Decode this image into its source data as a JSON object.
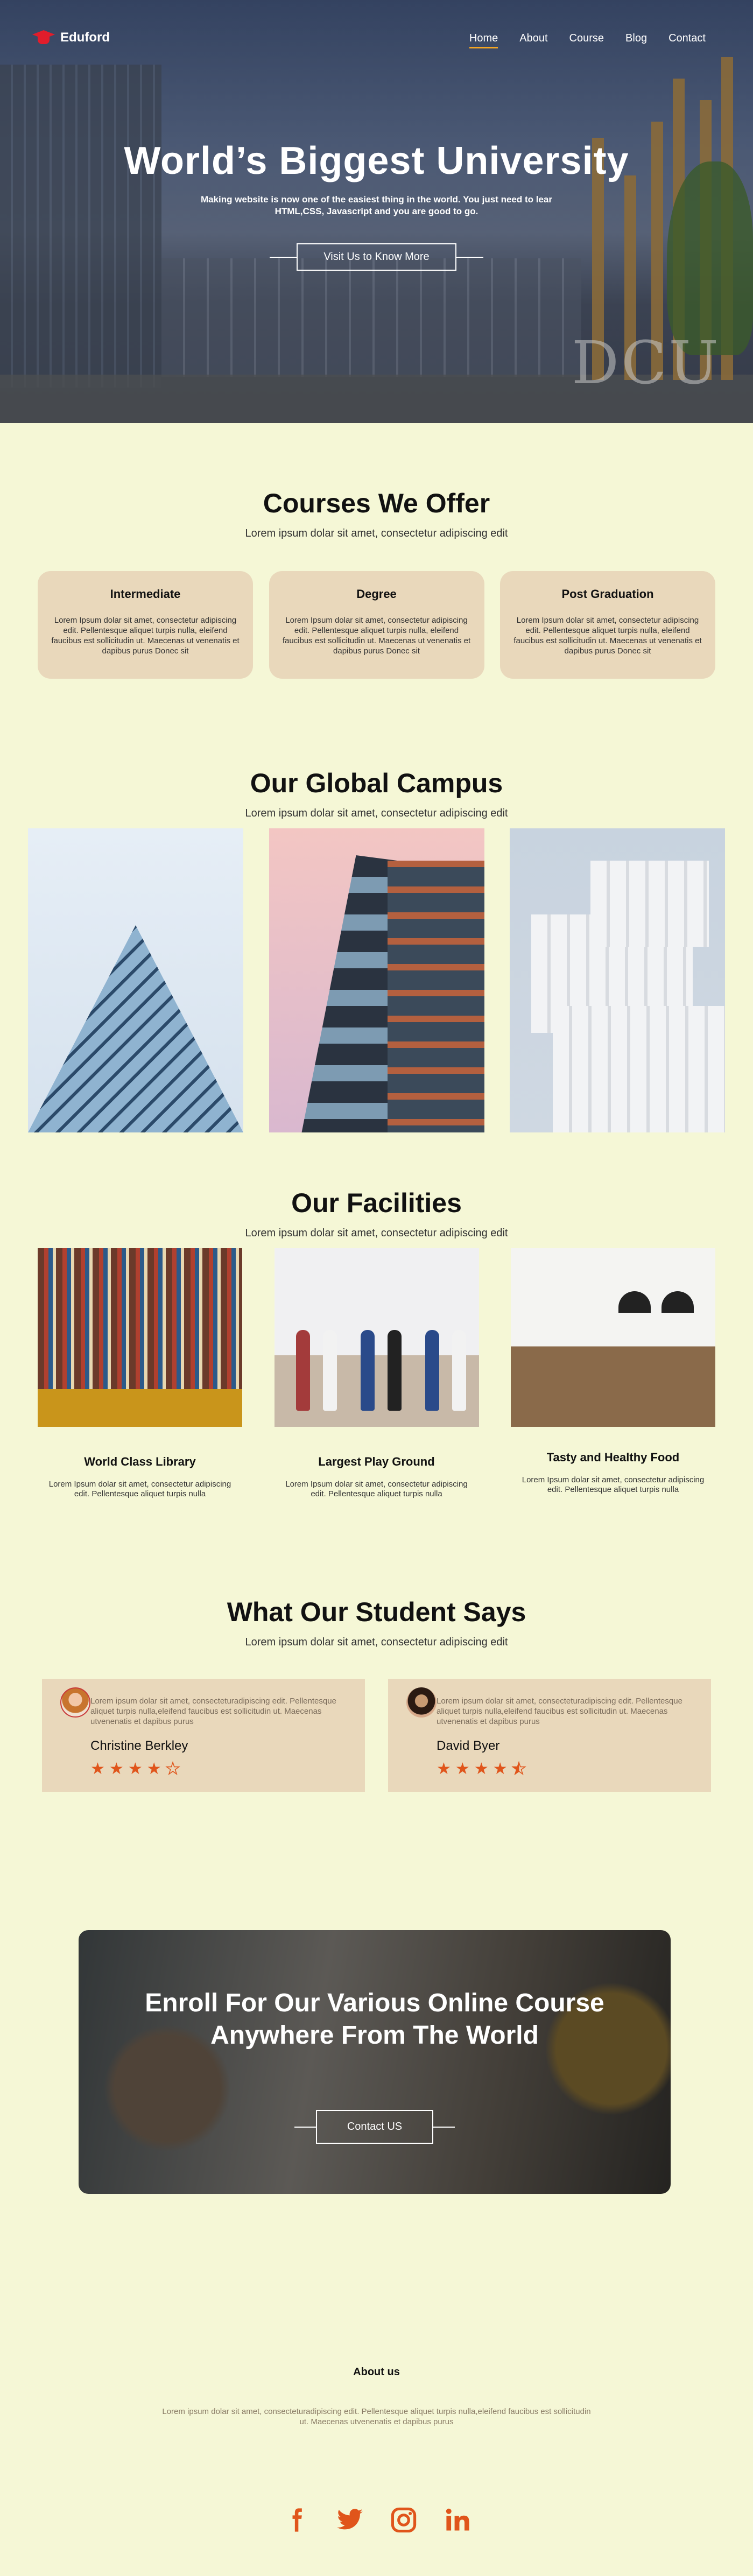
{
  "brand": {
    "name": "Eduford",
    "accent": "#f5a623",
    "logo_color": "#e11d2b",
    "star_color": "#e0551b",
    "card_color": "#e9d8bb",
    "page_bg": "#f5f7d6"
  },
  "nav": {
    "items": [
      {
        "label": "Home",
        "active": true
      },
      {
        "label": "About"
      },
      {
        "label": "Course"
      },
      {
        "label": "Blog"
      },
      {
        "label": "Contact"
      }
    ]
  },
  "hero": {
    "title": "World’s Biggest University",
    "subtitle": "Making website is now one of the easiest thing in the world. You just need to lear HTML,CSS, Javascript and you are good to go.",
    "button": "Visit Us to Know More",
    "sign_text": "DCU"
  },
  "courses": {
    "title": "Courses We Offer",
    "subtitle": "Lorem ipsum dolar sit amet, consectetur adipiscing  edit",
    "cards": [
      {
        "title": "Intermediate",
        "text": "Lorem Ipsum dolar sit amet, consectetur adipiscing edit. Pellentesque aliquet turpis nulla, eleifend faucibus est sollicitudin ut. Maecenas ut venenatis et dapibus purus Donec sit"
      },
      {
        "title": "Degree",
        "text": "Lorem Ipsum dolar sit amet, consectetur adipiscing edit. Pellentesque aliquet turpis nulla, eleifend faucibus est sollicitudin ut. Maecenas ut venenatis et dapibus purus Donec sit"
      },
      {
        "title": "Post Graduation",
        "text": "Lorem Ipsum dolar sit amet, consectetur adipiscing edit. Pellentesque aliquet turpis nulla, eleifend faucibus est sollicitudin ut. Maecenas ut venenatis et dapibus purus Donec sit"
      }
    ]
  },
  "campus": {
    "title": "Our Global Campus",
    "subtitle": "Lorem ipsum dolar sit amet, consectetur adipiscing  edit"
  },
  "facilities": {
    "title": "Our Facilities",
    "subtitle": "Lorem ipsum dolar sit amet, consectetur adipiscing  edit",
    "items": [
      {
        "title": "World Class Library",
        "text": "Lorem Ipsum dolar sit amet, consectetur adipiscing edit. Pellentesque aliquet turpis nulla"
      },
      {
        "title": "Largest Play Ground",
        "text": "Lorem Ipsum dolar sit amet, consectetur adipiscing edit. Pellentesque aliquet turpis nulla"
      },
      {
        "title": "Tasty and  Healthy Food",
        "text": "Lorem Ipsum dolar sit amet, consectetur adipiscing edit. Pellentesque aliquet turpis nulla"
      }
    ]
  },
  "students": {
    "title": "What Our Student Says",
    "subtitle": "Lorem ipsum dolar sit amet, consectetur adipiscing  edit",
    "reviews": [
      {
        "text": "Lorem ipsum dolar sit amet, consecteturadipiscing edit. Pellentesque aliquet turpis nulla,eleifend faucibus est sollicitudin ut. Maecenas utvenenatis et dapibus purus",
        "name": "Christine Berkley",
        "rating": 4
      },
      {
        "text": "Lorem ipsum dolar sit amet, consecteturadipiscing edit. Pellentesque aliquet turpis nulla,eleifend faucibus est sollicitudin ut. Maecenas utvenenatis et dapibus purus",
        "name": "David Byer",
        "rating": 4.5
      }
    ]
  },
  "enroll": {
    "title_line1": "Enroll For Our Various Online Course",
    "title_line2": "Anywhere From The World",
    "button": "Contact US"
  },
  "about": {
    "title": "About us",
    "text": "Lorem ipsum dolar sit amet, consecteturadipiscing edit.  Pellentesque aliquet turpis nulla,eleifend faucibus est sollicitudin ut. Maecenas utvenenatis et dapibus purus"
  },
  "social": [
    {
      "icon": "facebook-icon"
    },
    {
      "icon": "twitter-icon"
    },
    {
      "icon": "instagram-icon"
    },
    {
      "icon": "linkedin-icon"
    }
  ]
}
